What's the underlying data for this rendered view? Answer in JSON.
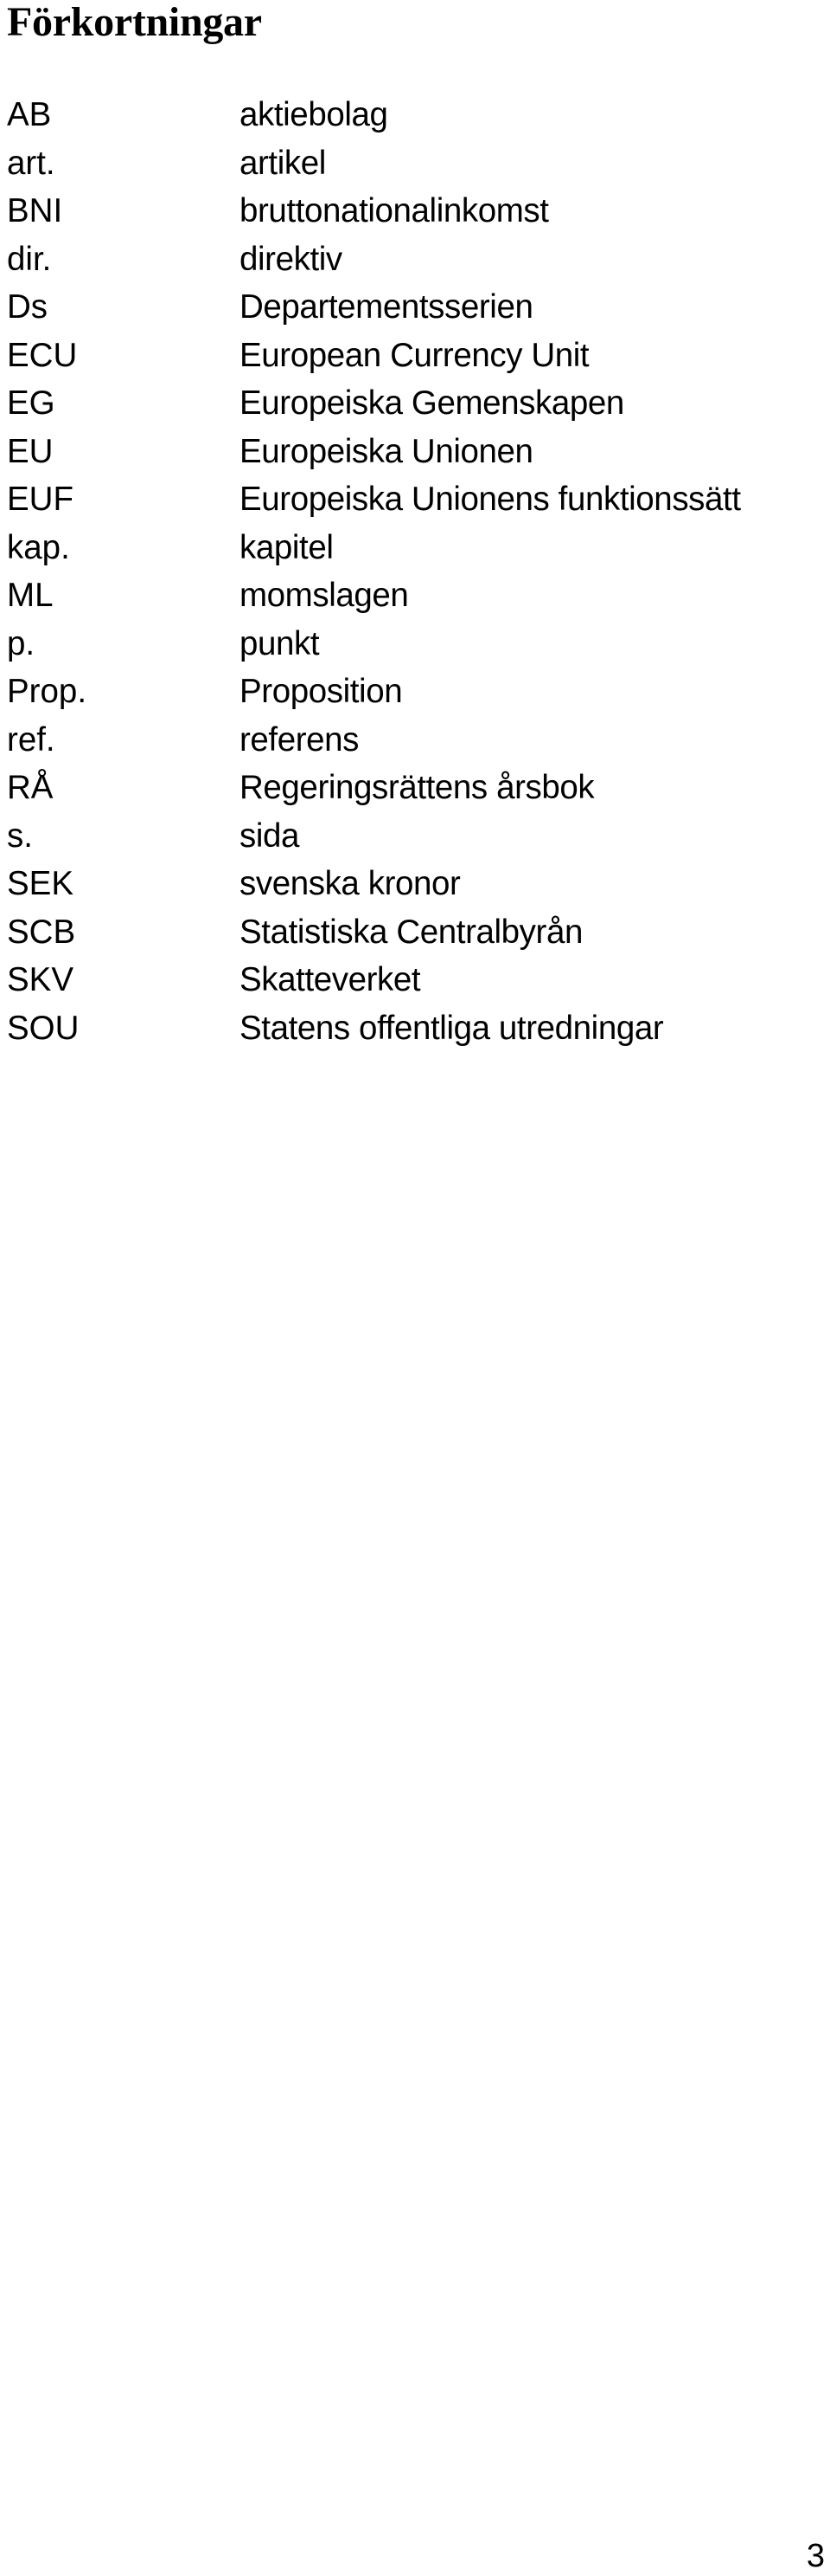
{
  "page": {
    "title": "Förkortningar",
    "page_number": "3"
  },
  "abbreviations": [
    {
      "term": "AB",
      "definition": "aktiebolag"
    },
    {
      "term": "art.",
      "definition": "artikel"
    },
    {
      "term": "BNI",
      "definition": "bruttonationalinkomst"
    },
    {
      "term": "dir.",
      "definition": "direktiv"
    },
    {
      "term": "Ds",
      "definition": "Departementsserien"
    },
    {
      "term": "ECU",
      "definition": "European Currency Unit"
    },
    {
      "term": "EG",
      "definition": "Europeiska Gemenskapen"
    },
    {
      "term": "EU",
      "definition": "Europeiska Unionen"
    },
    {
      "term": "EUF",
      "definition": "Europeiska Unionens funktionssätt"
    },
    {
      "term": "kap.",
      "definition": "kapitel"
    },
    {
      "term": "ML",
      "definition": "momslagen"
    },
    {
      "term": "p.",
      "definition": "punkt"
    },
    {
      "term": "Prop.",
      "definition": "Proposition"
    },
    {
      "term": "ref.",
      "definition": "referens"
    },
    {
      "term": "RÅ",
      "definition": "Regeringsrättens årsbok"
    },
    {
      "term": "s.",
      "definition": "sida"
    },
    {
      "term": "SEK",
      "definition": "svenska kronor"
    },
    {
      "term": "SCB",
      "definition": "Statistiska Centralbyrån"
    },
    {
      "term": "SKV",
      "definition": "Skatteverket"
    },
    {
      "term": "SOU",
      "definition": "Statens offentliga utredningar"
    }
  ]
}
